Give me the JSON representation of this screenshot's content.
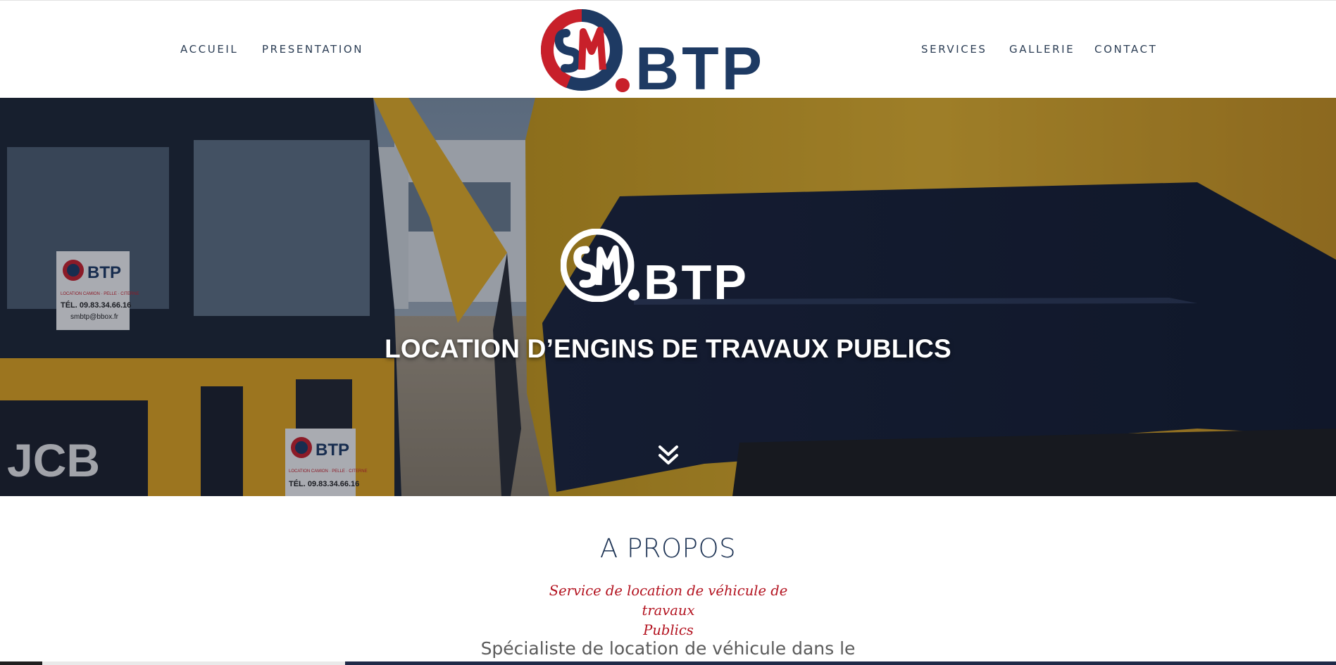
{
  "header": {
    "nav_left": [
      "ACCUEIL",
      "PRESENTATION"
    ],
    "nav_right": [
      "SERVICES",
      "GALLERIE",
      "CONTACT"
    ],
    "logo_text": "BTP",
    "brand_colors": {
      "navy": "#1e3a63",
      "red": "#c8202a"
    }
  },
  "hero": {
    "logo_text": "BTP",
    "title": "LOCATION D’ENGINS DE TRAVAUX PUBLICS",
    "scroll_icon": "double-chevron-down-icon",
    "sign_lines": [
      "BTP",
      "LOCATION CAMION · PELLE · CITERNE",
      "TÉL. 09.83.34.66.16",
      "smbtp@bbox.fr"
    ],
    "machine_brand": "JCB"
  },
  "about": {
    "title": "A PROPOS",
    "subtitle_line1": "Service de location de véhicule de travaux",
    "subtitle_line2": "Publics",
    "body": "Spécialiste de location de véhicule dans le"
  }
}
